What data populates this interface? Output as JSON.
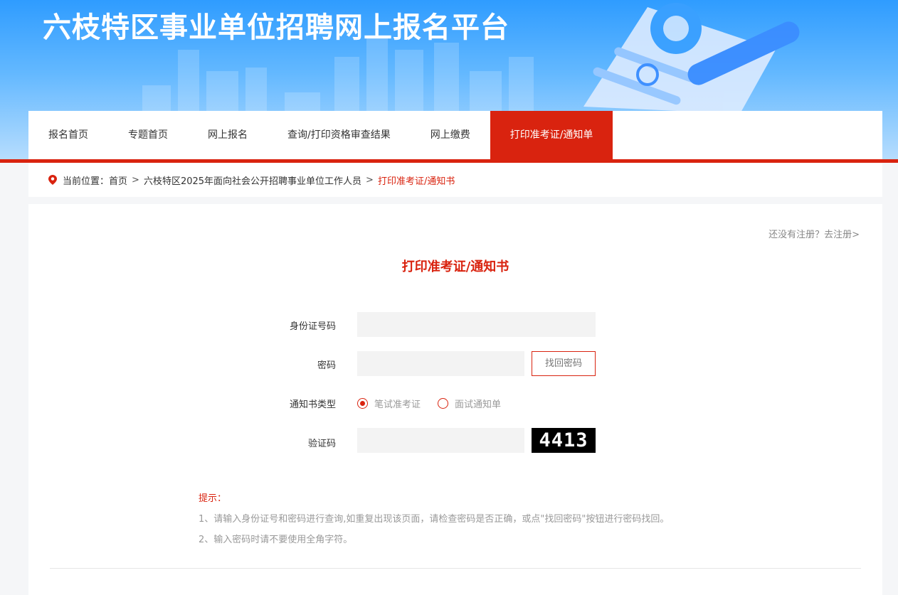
{
  "header": {
    "title": "六枝特区事业单位招聘网上报名平台"
  },
  "nav": {
    "items": [
      {
        "label": "报名首页"
      },
      {
        "label": "专题首页"
      },
      {
        "label": "网上报名"
      },
      {
        "label": "查询/打印资格审查结果"
      },
      {
        "label": "网上缴费"
      },
      {
        "label": "打印准考证/通知单",
        "active": true
      }
    ]
  },
  "breadcrumb": {
    "prefix": "当前位置：",
    "items": [
      "首页",
      "六枝特区2025年面向社会公开招聘事业单位工作人员",
      "打印准考证/通知书"
    ],
    "separator": ">"
  },
  "register_link": "还没有注册？去注册>",
  "form": {
    "title": "打印准考证/通知书",
    "id_label": "身份证号码",
    "id_value": "",
    "password_label": "密码",
    "password_value": "",
    "forgot_button": "找回密码",
    "type_label": "通知书类型",
    "type_options": [
      {
        "label": "笔试准考证",
        "checked": true
      },
      {
        "label": "面试通知单",
        "checked": false
      }
    ],
    "captcha_label": "验证码",
    "captcha_value": "",
    "captcha_text": "4413"
  },
  "tips": {
    "title": "提示：",
    "items": [
      "1、请输入身份证号和密码进行查询,如重复出现该页面，请检查密码是否正确，或点\"找回密码\"按钮进行密码找回。",
      "2、输入密码时请不要使用全角字符。"
    ]
  },
  "colors": {
    "accent": "#d9230f",
    "banner": "#2f9cff"
  }
}
